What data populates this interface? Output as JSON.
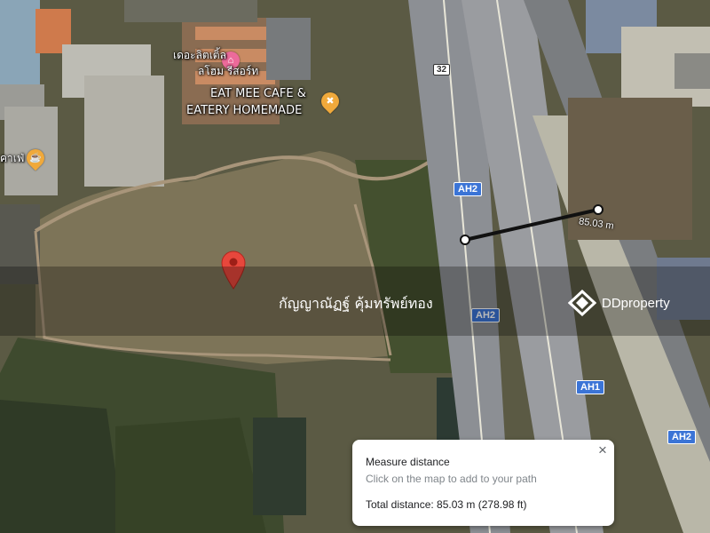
{
  "map": {
    "poi_resort_name": "เดอะลิตเติ้ล",
    "poi_resort_name_2": "ลโฮม รีสอร์ท",
    "poi_cafe_line1": "EAT MEE CAFE &",
    "poi_cafe_line2": "EATERY HOMEMADE",
    "poi_left_cafe": "คาเฟ่",
    "route_shield_32": "32",
    "highway_labels": [
      "AH2",
      "AH2",
      "AH1",
      "AH2"
    ],
    "owner_name": "กัญญาณัฏฐ์ คุ้มทรัพย์ทอง",
    "brand": "DDproperty",
    "measure_line_label": "85.03 m",
    "colors": {
      "pin": "#e8473c",
      "food_poi": "#f0a93b",
      "lodging_poi": "#ec6a9a",
      "shield": "#3b74d6"
    }
  },
  "measure_panel": {
    "title": "Measure distance",
    "hint": "Click on the map to add to your path",
    "total": "Total distance: 85.03 m (278.98 ft)",
    "close": "×"
  }
}
